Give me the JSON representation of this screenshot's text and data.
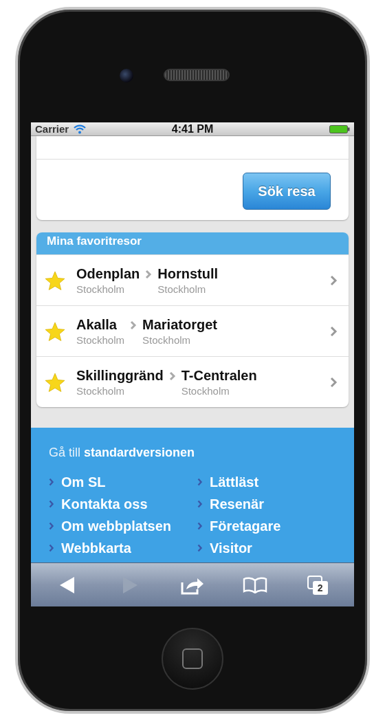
{
  "status_bar": {
    "carrier": "Carrier",
    "time": "4:41 PM"
  },
  "search_button": "Sök resa",
  "favorites": {
    "title": "Mina favoritresor",
    "trips": [
      {
        "from": "Odenplan",
        "from_city": "Stockholm",
        "to": "Hornstull",
        "to_city": "Stockholm"
      },
      {
        "from": "Akalla",
        "from_city": "Stockholm",
        "to": "Mariatorget",
        "to_city": "Stockholm"
      },
      {
        "from": "Skillinggränd",
        "from_city": "Stockholm",
        "to": "T-Centralen",
        "to_city": "Stockholm"
      }
    ]
  },
  "footer": {
    "standard_link": "Gå till **standardversionen**",
    "link_columns": [
      [
        "Om SL",
        "Kontakta oss",
        "Om webbplatsen",
        "Webbkarta"
      ],
      [
        "Lättläst",
        "Resenär",
        "Företagare",
        "Visitor"
      ]
    ]
  },
  "toolbar": {
    "buttons": [
      {
        "kind": "back",
        "disabled": false
      },
      {
        "kind": "forward",
        "disabled": true
      },
      {
        "kind": "share",
        "disabled": false
      },
      {
        "kind": "bookmarks",
        "disabled": false
      },
      {
        "kind": "tabs",
        "disabled": false,
        "count": "2"
      }
    ]
  }
}
